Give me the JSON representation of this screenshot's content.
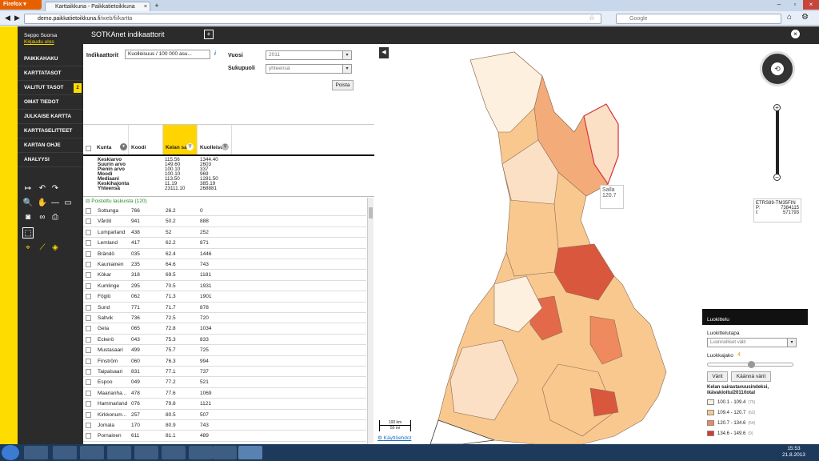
{
  "browser": {
    "firefox_label": "Firefox",
    "tab_title": "Karttaikkuna - Paikkatietoikkuna",
    "url_host": "demo.paikkatietoikkuna.fi",
    "url_path": "/web/fi/kartta",
    "search_placeholder": "Google"
  },
  "app": {
    "title": "SOTKAnet indikaattorit",
    "user_name": "Seppo Suorsa",
    "logout": "Kirjaudu ulos"
  },
  "sidebar": {
    "items": [
      {
        "label": "PAIKKAHAKU"
      },
      {
        "label": "KARTTATASOT"
      },
      {
        "label": "VALITUT TASOT",
        "badge": "2"
      },
      {
        "label": "OMAT TIEDOT"
      },
      {
        "label": "JULKAISE KARTTA"
      },
      {
        "label": "KARTTASELITTEET"
      },
      {
        "label": "KARTAN OHJE"
      },
      {
        "label": "ANALYYSI"
      }
    ]
  },
  "filters": {
    "indicator_label": "Indikaattorit",
    "indicator_value": "Kuolleisuus / 100 000 asu...",
    "year_label": "Vuosi",
    "year_value": "2011",
    "gender_label": "Sukupuoli",
    "gender_value": "yhteensä",
    "remove_button": "Poista"
  },
  "table": {
    "headers": [
      "Kunta",
      "Koodi",
      "Kelan sai",
      "Kuolleisu"
    ],
    "stats_labels": [
      "Keskiarvo",
      "Suurin arvo",
      "Pienin arvo",
      "Moodi",
      "Mediaani",
      "Keskihajonta",
      "Yhteensä"
    ],
    "stats_col1": [
      "115.56",
      "149.60",
      "100.10",
      "100.10",
      "113.50",
      "11.19",
      "23111.10"
    ],
    "stats_col2": [
      "1344.40",
      "2603",
      "337",
      "969",
      "1281.50",
      "385.19",
      "268881"
    ],
    "group_label": "Poistettu laskuista (120)",
    "rows": [
      [
        "Sottunga",
        "766",
        "26.2",
        "0"
      ],
      [
        "Vårdö",
        "941",
        "50.2",
        "888"
      ],
      [
        "Lumparland",
        "438",
        "52",
        "252"
      ],
      [
        "Lemland",
        "417",
        "62.2",
        "871"
      ],
      [
        "Brändö",
        "035",
        "62.4",
        "1446"
      ],
      [
        "Kauniainen",
        "235",
        "64.6",
        "743"
      ],
      [
        "Kökar",
        "318",
        "69.5",
        "1181"
      ],
      [
        "Kumlinge",
        "295",
        "70.5",
        "1931"
      ],
      [
        "Föglö",
        "062",
        "71.3",
        "1901"
      ],
      [
        "Sund",
        "771",
        "71.7",
        "878"
      ],
      [
        "Saltvik",
        "736",
        "72.5",
        "720"
      ],
      [
        "Geta",
        "065",
        "72.8",
        "1034"
      ],
      [
        "Eckerö",
        "043",
        "75.3",
        "833"
      ],
      [
        "Mustasaari",
        "499",
        "75.7",
        "725"
      ],
      [
        "Finström",
        "060",
        "76.3",
        "994"
      ],
      [
        "Taipalsaari",
        "831",
        "77.1",
        "737"
      ],
      [
        "Espoo",
        "049",
        "77.2",
        "521"
      ],
      [
        "Maarianha...",
        "478",
        "77.6",
        "1069"
      ],
      [
        "Hammarland",
        "076",
        "79.8",
        "1121"
      ],
      [
        "Kirkkonum...",
        "257",
        "80.5",
        "507"
      ],
      [
        "Jomala",
        "170",
        "80.9",
        "743"
      ],
      [
        "Pornainen",
        "611",
        "81.1",
        "489"
      ]
    ]
  },
  "map": {
    "tooltip_name": "Salla",
    "tooltip_value": "120.7",
    "crs": "ETRS89-TM35FIN",
    "p_label": "P:",
    "p_value": "7384115",
    "i_label": "I:",
    "i_value": "571793",
    "scale_top": "100 km",
    "scale_bottom": "50 mi",
    "terms": "Käyttöehdot"
  },
  "classification": {
    "header": "Luokittelu",
    "method_label": "Luokittelutapa",
    "method_value": "Luonnolliset välit",
    "count_label": "Luokkajako",
    "count_value": "4",
    "colors_button": "Värit",
    "flip_button": "Käännä värit",
    "legend_title": "Kelan sairastavuusindeksi, ikävakioitu/2011/total",
    "classes": [
      {
        "range": "100.1 - 109.4",
        "count": "(75)",
        "color": "#fdf0de"
      },
      {
        "range": "109.4 - 120.7",
        "count": "(62)",
        "color": "#f8c88f"
      },
      {
        "range": "120.7 - 134.6",
        "count": "(54)",
        "color": "#ee8a5e"
      },
      {
        "range": "134.6 - 149.6",
        "count": "(9)",
        "color": "#d43c2e"
      }
    ]
  },
  "taskbar": {
    "time": "15:53",
    "date": "21.8.2013"
  }
}
